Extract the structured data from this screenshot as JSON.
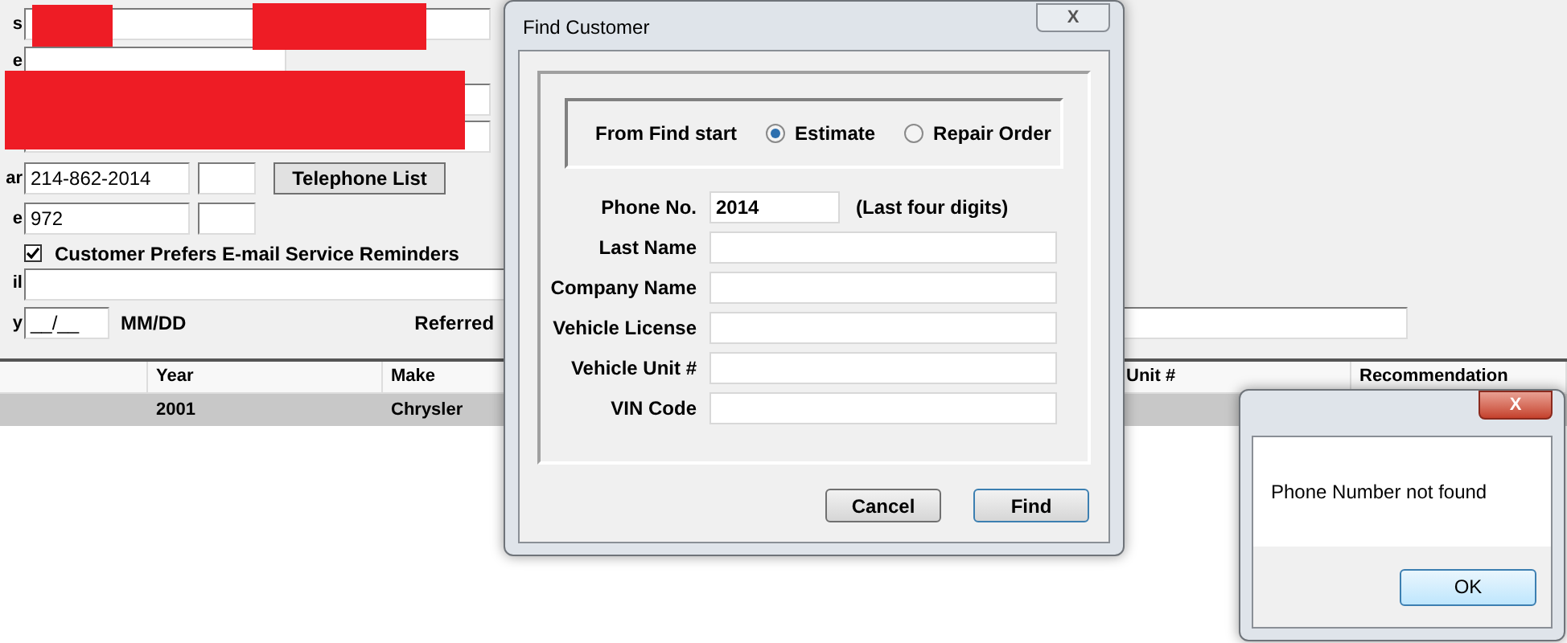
{
  "customer_form": {
    "first_label": "s",
    "second_label": "e",
    "phone_1": {
      "label": "ar",
      "value": "214-862-2014"
    },
    "phone_2": {
      "label": "e",
      "value": "972"
    },
    "telephone_list_button": "Telephone List",
    "email_reminders": {
      "label": "Customer Prefers E-mail Service Reminders",
      "checked": true
    },
    "email": {
      "label": "il"
    },
    "birthday": {
      "label": "y",
      "value": "__/__",
      "format": "MM/DD"
    },
    "referred_label": "Referred"
  },
  "vehicle_table": {
    "columns": [
      "Year",
      "Make",
      "Unit #",
      "Recommendation"
    ],
    "rows": [
      {
        "selected": true,
        "cells": [
          "2001",
          "Chrysler"
        ]
      }
    ]
  },
  "find_dialog": {
    "title": "Find Customer",
    "close": "X",
    "start_label": "From Find start",
    "start_options": [
      {
        "label": "Estimate",
        "selected": true
      },
      {
        "label": "Repair Order",
        "selected": false
      }
    ],
    "fields": [
      {
        "label": "Phone No.",
        "value": "2014",
        "note": "(Last four digits)"
      },
      {
        "label": "Last Name"
      },
      {
        "label": "Company Name"
      },
      {
        "label": "Vehicle License"
      },
      {
        "label": "Vehicle Unit #"
      },
      {
        "label": "VIN Code"
      }
    ],
    "buttons": [
      {
        "label": "Cancel",
        "default": false
      },
      {
        "label": "Find",
        "default": true
      }
    ]
  },
  "message_box": {
    "close": "X",
    "message": "Phone Number not found",
    "button": "OK"
  }
}
